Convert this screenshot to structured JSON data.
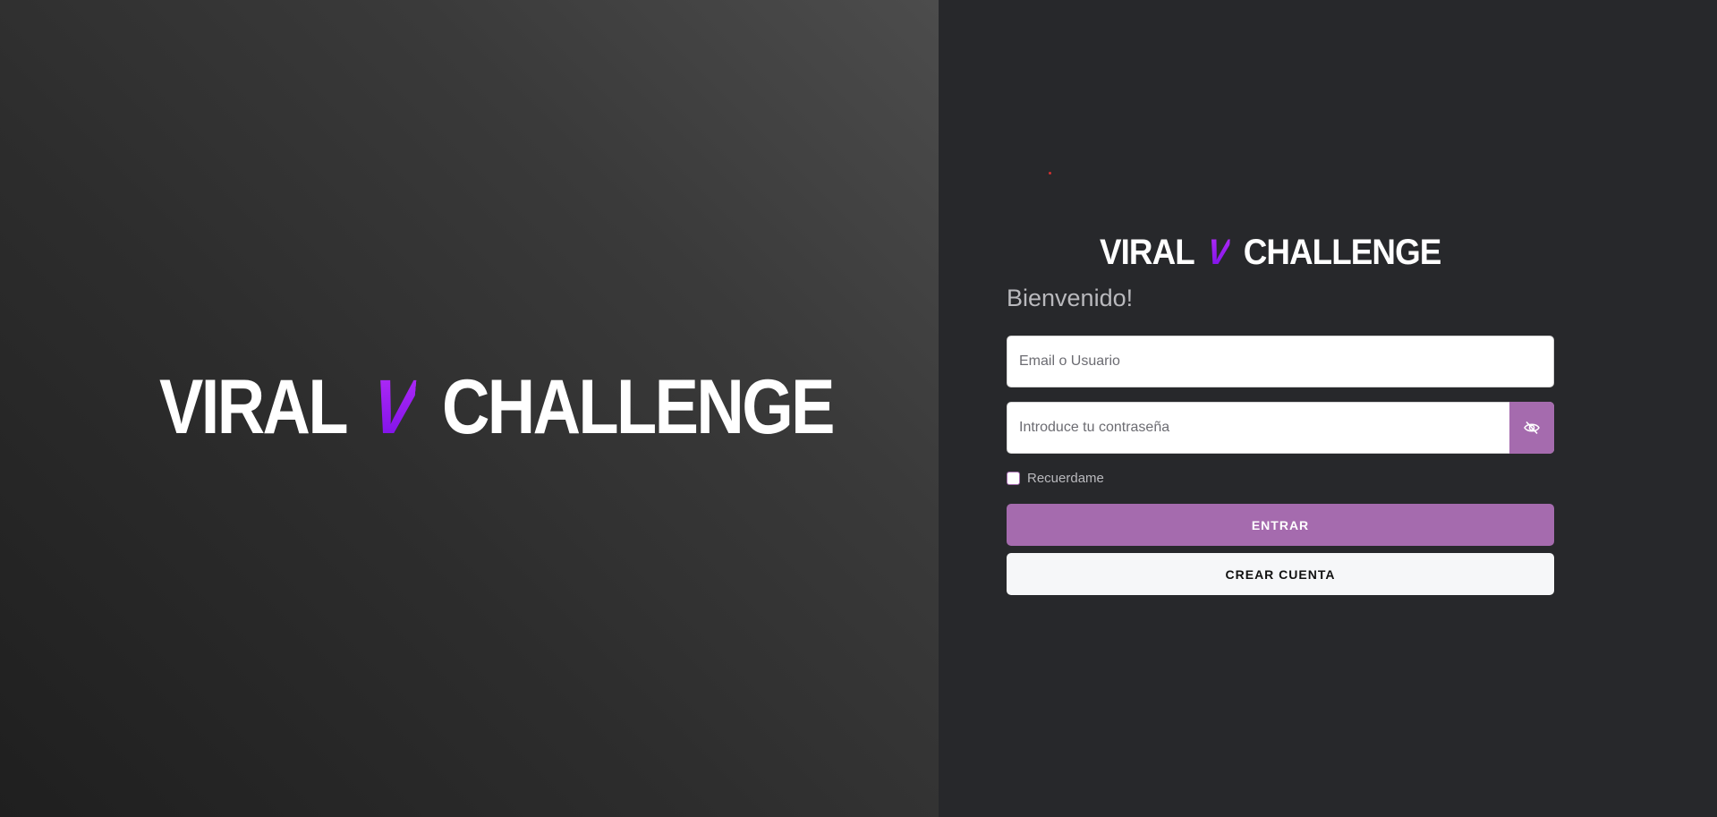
{
  "hero": {
    "logo": {
      "left": "VIRAL",
      "mark": "V",
      "right": "CHALLENGE"
    }
  },
  "login": {
    "logo": {
      "left": "VIRAL",
      "mark": "V",
      "right": "CHALLENGE"
    },
    "welcome": "Bienvenido!",
    "email_placeholder": "Email o Usuario",
    "password_placeholder": "Introduce tu contraseña",
    "remember_label": "Recuerdame",
    "login_button": "ENTRAR",
    "create_button": "CREAR CUENTA",
    "toggle_icon": "eye-slash-icon"
  },
  "colors": {
    "accent": "#a56bae",
    "brand_purple": "#9b1df0",
    "panel_bg": "#27282b",
    "status_dot": "#d23030"
  }
}
